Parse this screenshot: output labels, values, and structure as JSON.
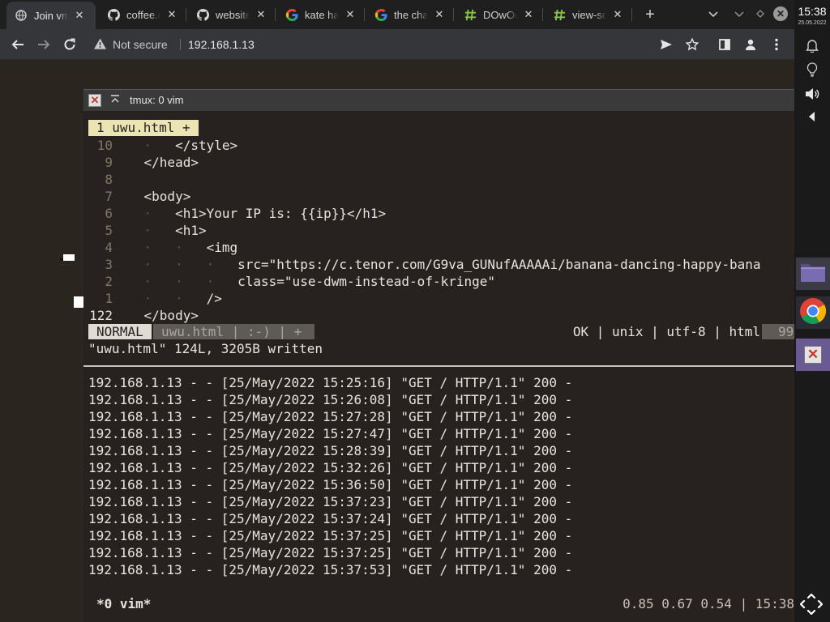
{
  "browser": {
    "tabs": [
      {
        "label": "Join vm",
        "icon": "globe-icon",
        "active": true
      },
      {
        "label": "coffee.c",
        "icon": "github-icon"
      },
      {
        "label": "website",
        "icon": "github-icon"
      },
      {
        "label": "kate ha",
        "icon": "google-icon"
      },
      {
        "label": "the cha",
        "icon": "google-icon"
      },
      {
        "label": "DOwOc",
        "icon": "hashtag-icon"
      },
      {
        "label": "view-so",
        "icon": "hashtag-icon"
      }
    ],
    "new_tab": "+",
    "security_label": "Not secure",
    "url": "192.168.1.13"
  },
  "terminal": {
    "title": "tmux: 0 vim",
    "vim": {
      "tab_label": "1 uwu.html +",
      "lines": [
        {
          "num": "10",
          "indent": "    · ",
          "code": "  </style>"
        },
        {
          "num": "9",
          "indent": "    ",
          "code": "</head>"
        },
        {
          "num": "8",
          "indent": "",
          "code": ""
        },
        {
          "num": "7",
          "indent": "    ",
          "code": "<body>"
        },
        {
          "num": "6",
          "indent": "    · ",
          "code": "  <h1>Your IP is: {{ip}}</h1>"
        },
        {
          "num": "5",
          "indent": "    · ",
          "code": "  <h1>"
        },
        {
          "num": "4",
          "indent": "    ·   · ",
          "code": "  <img"
        },
        {
          "num": "3",
          "indent": "    ·   ·   · ",
          "code": "  src=\"https://c.tenor.com/G9va_GUNufAAAAAi/banana-dancing-happy-bana"
        },
        {
          "num": "2",
          "indent": "    ·   ·   · ",
          "code": "  class=\"use-dwm-instead-of-kringe\""
        },
        {
          "num": "1",
          "indent": "    ·   · ",
          "code": "  />"
        },
        {
          "num": "122",
          "indent": "    ",
          "code": "</body>",
          "current": true
        }
      ],
      "mode": "NORMAL",
      "file_segment": "uwu.html | :-) | +",
      "status_info": "OK | unix | utf-8 | html",
      "percent": "99",
      "message": "\"uwu.html\" 124L, 3205B written"
    },
    "log_lines": [
      "192.168.1.13 - - [25/May/2022 15:25:16] \"GET / HTTP/1.1\" 200 -",
      "192.168.1.13 - - [25/May/2022 15:26:08] \"GET / HTTP/1.1\" 200 -",
      "192.168.1.13 - - [25/May/2022 15:27:28] \"GET / HTTP/1.1\" 200 -",
      "192.168.1.13 - - [25/May/2022 15:27:47] \"GET / HTTP/1.1\" 200 -",
      "192.168.1.13 - - [25/May/2022 15:28:39] \"GET / HTTP/1.1\" 200 -",
      "192.168.1.13 - - [25/May/2022 15:32:26] \"GET / HTTP/1.1\" 200 -",
      "192.168.1.13 - - [25/May/2022 15:36:50] \"GET / HTTP/1.1\" 200 -",
      "192.168.1.13 - - [25/May/2022 15:37:23] \"GET / HTTP/1.1\" 200 -",
      "192.168.1.13 - - [25/May/2022 15:37:24] \"GET / HTTP/1.1\" 200 -",
      "192.168.1.13 - - [25/May/2022 15:37:25] \"GET / HTTP/1.1\" 200 -",
      "192.168.1.13 - - [25/May/2022 15:37:25] \"GET / HTTP/1.1\" 200 -",
      "192.168.1.13 - - [25/May/2022 15:37:53] \"GET / HTTP/1.1\" 200 -"
    ],
    "tmux": {
      "window": "*0 vim*",
      "right": "0.85 0.67 0.54 | 15:38"
    }
  },
  "panel": {
    "time": "15:38",
    "date": "25.05.2022",
    "icons": [
      "bell-icon",
      "lightbulb-icon",
      "speaker-icon",
      "collapse-arrow-icon"
    ],
    "dock": [
      "folder-icon",
      "chrome-icon",
      "close-window-icon"
    ]
  },
  "colors": {
    "terminal_bg": "#272220",
    "vim_tab_bg": "#ebe5b4",
    "active_dock_bg": "#6a5a94"
  }
}
